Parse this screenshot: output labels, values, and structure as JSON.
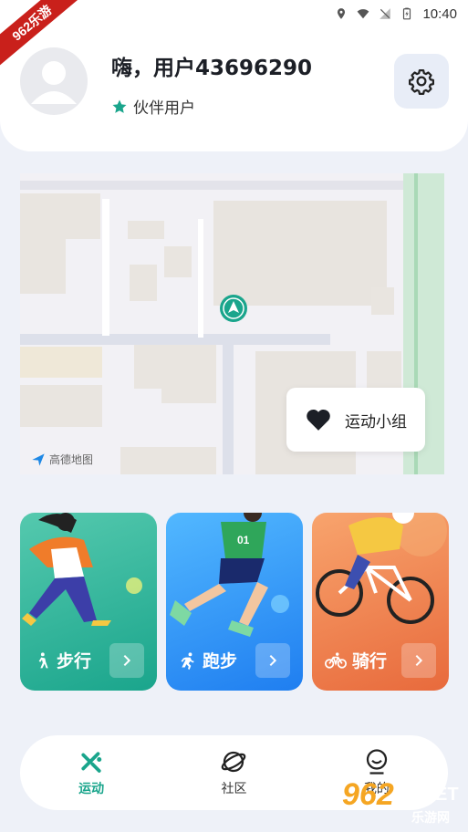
{
  "status_bar": {
    "time": "10:40"
  },
  "watermark_ribbon": "962乐游",
  "profile": {
    "username": "嗨，用户43696290",
    "badge": "伙伴用户"
  },
  "map": {
    "group_button_label": "运动小组",
    "logo_text": "高德地图"
  },
  "activities": [
    {
      "label": "步行",
      "color": "#1aa58c"
    },
    {
      "label": "跑步",
      "color": "#1f7ef0"
    },
    {
      "label": "骑行",
      "color": "#e86a3c"
    }
  ],
  "bottom_nav": {
    "items": [
      {
        "label": "运动",
        "icon": "run-icon",
        "active": true
      },
      {
        "label": "社区",
        "icon": "planet-icon",
        "active": false
      },
      {
        "label": "我的",
        "icon": "user-face-icon",
        "active": false
      }
    ]
  },
  "corner_watermark": {
    "big": "962",
    "net": ".NET",
    "sub": "乐游网"
  },
  "colors": {
    "accent": "#1aa58c",
    "background": "#eef1f8"
  }
}
